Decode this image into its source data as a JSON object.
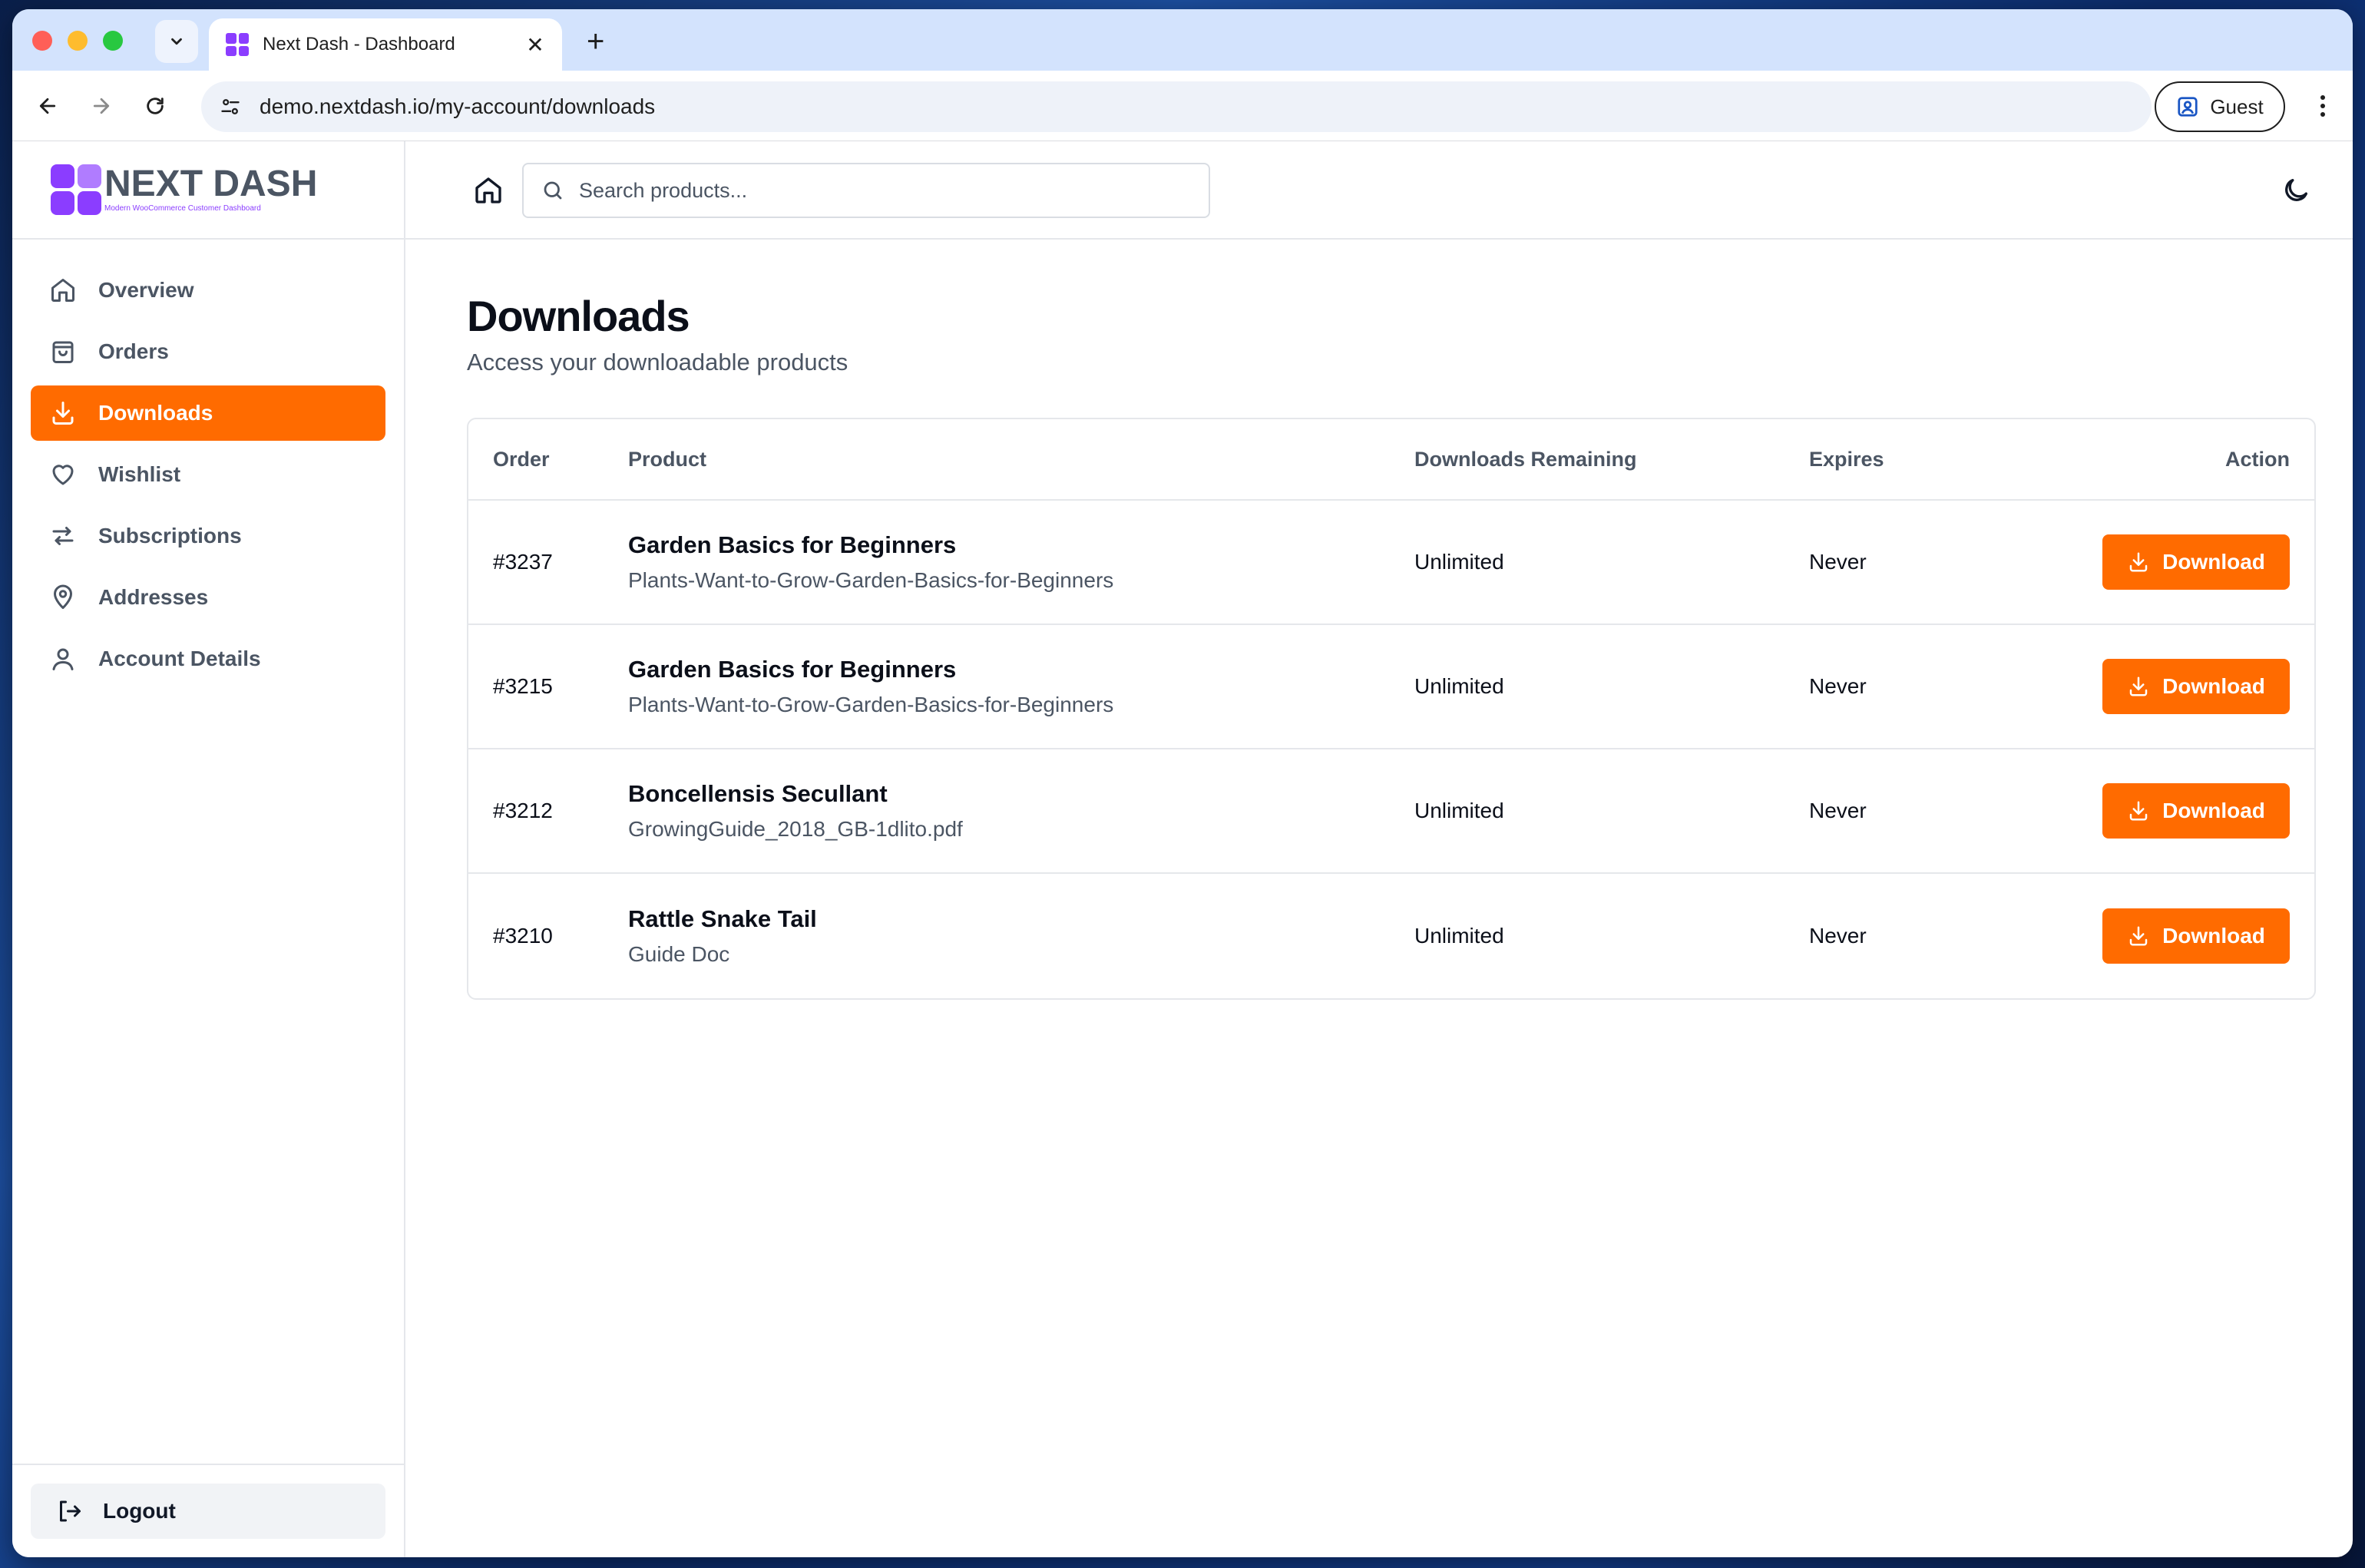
{
  "browser": {
    "tab_title": "Next Dash - Dashboard",
    "url": "demo.nextdash.io/my-account/downloads",
    "profile_label": "Guest"
  },
  "brand": {
    "name": "NEXT DASH",
    "tagline": "Modern WooCommerce Customer Dashboard",
    "accent_color": "#8b3dff"
  },
  "sidebar": {
    "items": [
      {
        "label": "Overview",
        "icon": "home-icon"
      },
      {
        "label": "Orders",
        "icon": "shopping-bag-icon"
      },
      {
        "label": "Downloads",
        "icon": "download-icon",
        "active": true
      },
      {
        "label": "Wishlist",
        "icon": "heart-icon"
      },
      {
        "label": "Subscriptions",
        "icon": "repeat-icon"
      },
      {
        "label": "Addresses",
        "icon": "map-pin-icon"
      },
      {
        "label": "Account Details",
        "icon": "user-icon"
      }
    ],
    "logout_label": "Logout",
    "active_color": "#ff6b00"
  },
  "topbar": {
    "search_placeholder": "Search products..."
  },
  "page": {
    "title": "Downloads",
    "subtitle": "Access your downloadable products"
  },
  "table": {
    "headers": {
      "order": "Order",
      "product": "Product",
      "remaining": "Downloads Remaining",
      "expires": "Expires",
      "action": "Action"
    },
    "rows": [
      {
        "order": "#3237",
        "product": "Garden Basics for Beginners",
        "file": "Plants-Want-to-Grow-Garden-Basics-for-Beginners",
        "remaining": "Unlimited",
        "expires": "Never",
        "action": "Download"
      },
      {
        "order": "#3215",
        "product": "Garden Basics for Beginners",
        "file": "Plants-Want-to-Grow-Garden-Basics-for-Beginners",
        "remaining": "Unlimited",
        "expires": "Never",
        "action": "Download"
      },
      {
        "order": "#3212",
        "product": "Boncellensis Secullant",
        "file": "GrowingGuide_2018_GB-1dlito.pdf",
        "remaining": "Unlimited",
        "expires": "Never",
        "action": "Download"
      },
      {
        "order": "#3210",
        "product": "Rattle Snake Tail",
        "file": "Guide Doc",
        "remaining": "Unlimited",
        "expires": "Never",
        "action": "Download"
      }
    ]
  }
}
